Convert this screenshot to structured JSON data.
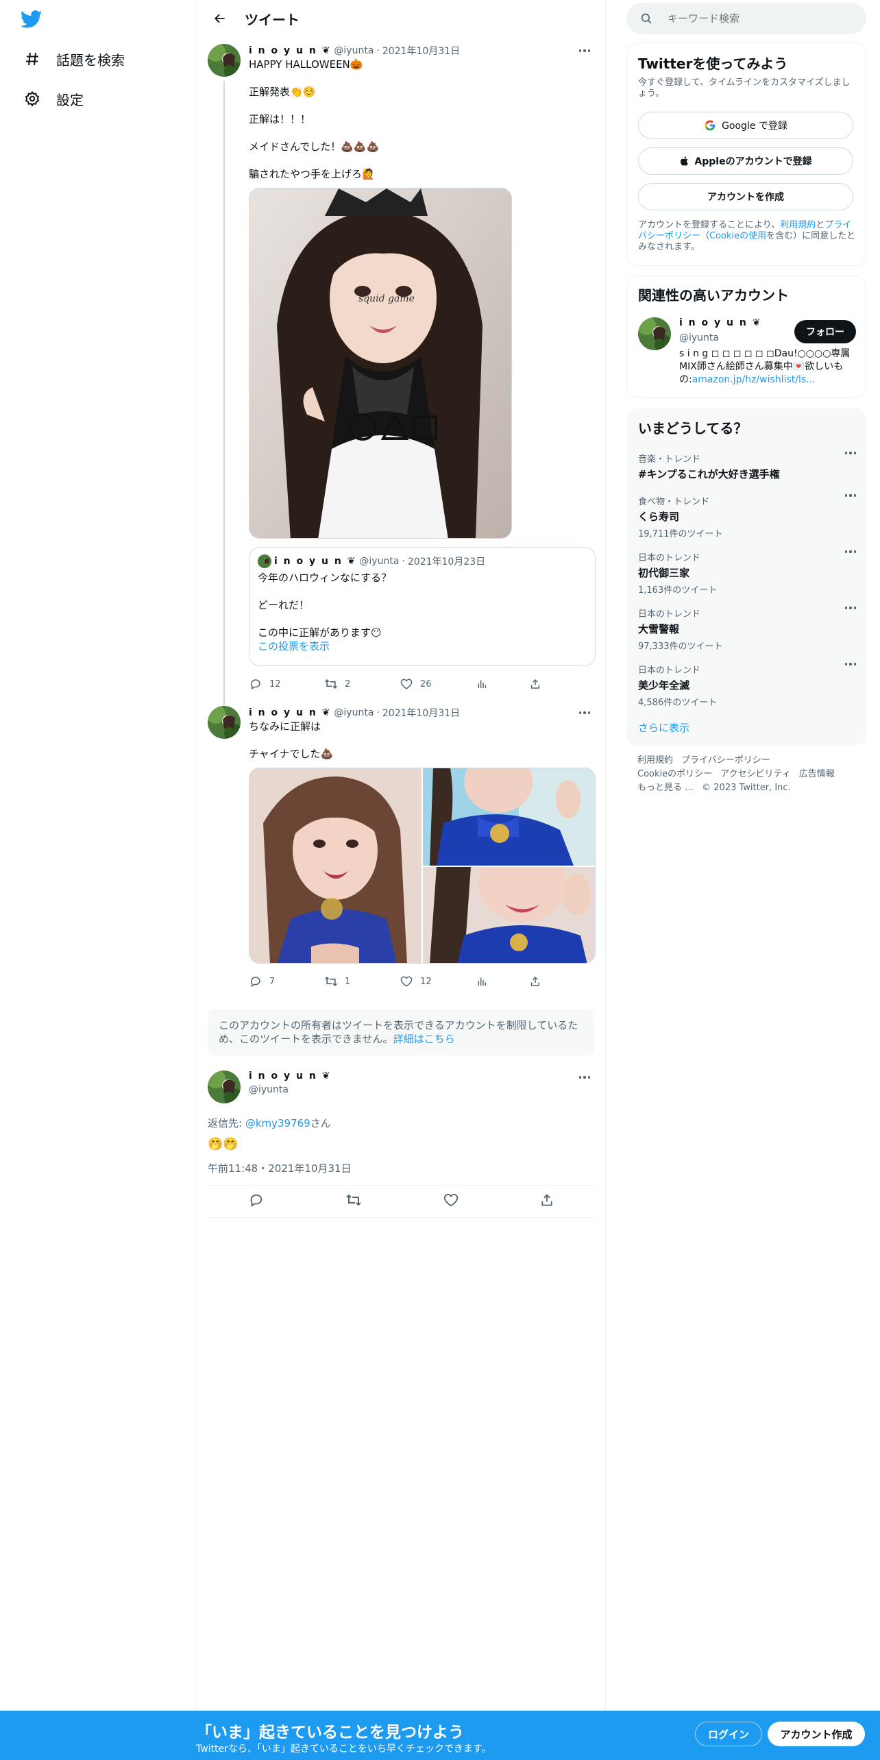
{
  "nav": {
    "logo": "twitter-bird-icon",
    "items": [
      {
        "label": "話題を検索",
        "icon": "hashtag-icon"
      },
      {
        "label": "設定",
        "icon": "gear-icon"
      }
    ]
  },
  "header": {
    "title": "ツイート",
    "back_icon": "arrow-left-icon"
  },
  "tweets": [
    {
      "name": "i n o y u n ❦",
      "handle": "@iyunta",
      "date": "2021年10月31日",
      "lines": [
        "HAPPY HALLOWEEN🎃",
        "正解発表👏☺️",
        "正解は！！！",
        "メイドさんでした！💩💩💩",
        "騙されたやつ手を上げろ🙋"
      ],
      "image_caption": "squid game",
      "quote": {
        "name": "i n o y u n ❦",
        "handle": "@iyunta",
        "date": "2021年10月23日",
        "lines": [
          "今年のハロウィンなにする？",
          "どーれだ！",
          "この中に正解があります😶"
        ],
        "poll_link": "この投票を表示"
      },
      "stats": {
        "replies": "12",
        "retweets": "2",
        "likes": "26"
      }
    },
    {
      "name": "i n o y u n ❦",
      "handle": "@iyunta",
      "date": "2021年10月31日",
      "lines": [
        "ちなみに正解は",
        "チャイナでした💩"
      ],
      "stats": {
        "replies": "7",
        "retweets": "1",
        "likes": "12"
      }
    }
  ],
  "notice": {
    "text": "このアカウントの所有者はツイートを表示できるアカウントを制限しているため、このツイートを表示できません。",
    "link": "詳細はこちら"
  },
  "main_tweet": {
    "name": "i n o y u n ❦",
    "handle": "@iyunta",
    "reply_prefix": "返信先: ",
    "reply_to": "@kmy39769",
    "reply_suffix": "さん",
    "text": "🤭🤭",
    "timestamp": "午前11:48・2021年10月31日"
  },
  "sidebar": {
    "search_placeholder": "キーワード検索",
    "signup": {
      "title": "Twitterを使ってみよう",
      "subtitle": "今すぐ登録して、タイムラインをカスタマイズしましょう。",
      "google": "Google で登録",
      "apple": "Appleのアカウントで登録",
      "create": "アカウントを作成",
      "terms_prefix": "アカウントを登録することにより、",
      "terms_link": "利用規約",
      "terms_and": "と",
      "privacy_link": "プライバシーポリシー",
      "terms_paren_open": "（",
      "cookie_link": "Cookieの使用",
      "terms_suffix": "を含む）に同意したとみなされます。"
    },
    "related": {
      "title": "関連性の高いアカウント",
      "name": "i n o y u n ❦",
      "handle": "@iyunta",
      "follow": "フォロー",
      "bio": "s i n g ◻︎ ◻︎ ◻︎ ◻︎ ◻︎ ◻︎Dau!○○○○専属MIX師さん絵師さん募集中💌欲しいもの:",
      "bio_link": "amazon.jp/hz/wishlist/ls..."
    },
    "trends": {
      "title": "いまどうしてる？",
      "items": [
        {
          "category": "音楽・トレンド",
          "title": "#キンプるこれが大好き選手権",
          "count": ""
        },
        {
          "category": "食べ物・トレンド",
          "title": "くら寿司",
          "count": "19,711件のツイート"
        },
        {
          "category": "日本のトレンド",
          "title": "初代御三家",
          "count": "1,163件のツイート"
        },
        {
          "category": "日本のトレンド",
          "title": "大雪警報",
          "count": "97,333件のツイート"
        },
        {
          "category": "日本のトレンド",
          "title": "美少年全滅",
          "count": "4,586件のツイート"
        }
      ],
      "show_more": "さらに表示"
    },
    "footer": [
      "利用規約",
      "プライバシーポリシー",
      "Cookieのポリシー",
      "アクセシビリティ",
      "広告情報",
      "もっと見る …",
      "© 2023 Twitter, Inc."
    ]
  },
  "bottom_bar": {
    "title": "「いま」起きていることを見つけよう",
    "subtitle": "Twitterなら、「いま」起きていることをいち早くチェックできます。",
    "login": "ログイン",
    "signup": "アカウント作成"
  },
  "colors": {
    "accent": "#1d9bf0",
    "text": "#0f1419",
    "muted": "#536471",
    "border": "#eff3f4"
  }
}
